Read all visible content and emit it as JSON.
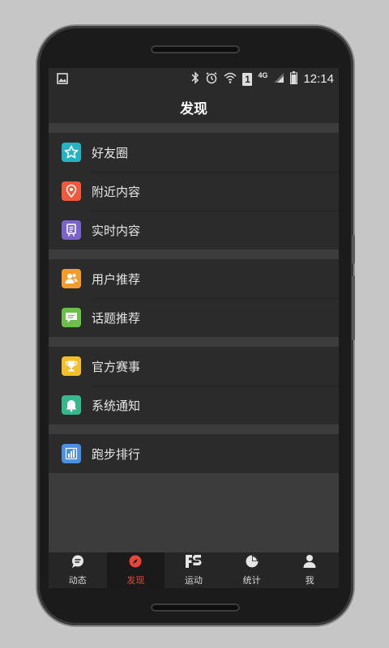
{
  "status_bar": {
    "time": "12:14",
    "network": "4G",
    "sim": "1",
    "icons": [
      "gallery-icon",
      "bluetooth-icon",
      "alarm-icon",
      "wifi-icon",
      "sim-icon",
      "signal-icon",
      "battery-icon"
    ]
  },
  "header": {
    "title": "发现"
  },
  "groups": [
    {
      "items": [
        {
          "label": "好友圈",
          "icon": "star-icon",
          "color": "#21b5c3"
        },
        {
          "label": "附近内容",
          "icon": "location-pin-icon",
          "color": "#f0593e"
        },
        {
          "label": "实时内容",
          "icon": "document-stand-icon",
          "color": "#7b63cc"
        }
      ]
    },
    {
      "items": [
        {
          "label": "用户推荐",
          "icon": "users-icon",
          "color": "#f39c2c"
        },
        {
          "label": "话题推荐",
          "icon": "chat-icon",
          "color": "#6cc04a"
        }
      ]
    },
    {
      "items": [
        {
          "label": "官方赛事",
          "icon": "trophy-icon",
          "color": "#f4be2a"
        },
        {
          "label": "系统通知",
          "icon": "bell-icon",
          "color": "#36b88e"
        }
      ]
    },
    {
      "items": [
        {
          "label": "跑步排行",
          "icon": "bar-chart-icon",
          "color": "#4a90e2"
        }
      ]
    }
  ],
  "tabs": [
    {
      "label": "动态",
      "icon": "speech-bubble-icon",
      "active": false
    },
    {
      "label": "发现",
      "icon": "compass-icon",
      "active": true,
      "color": "#e8463a"
    },
    {
      "label": "运动",
      "icon": "fs-logo-icon",
      "active": false
    },
    {
      "label": "统计",
      "icon": "pie-chart-icon",
      "active": false
    },
    {
      "label": "我",
      "icon": "person-icon",
      "active": false
    }
  ]
}
